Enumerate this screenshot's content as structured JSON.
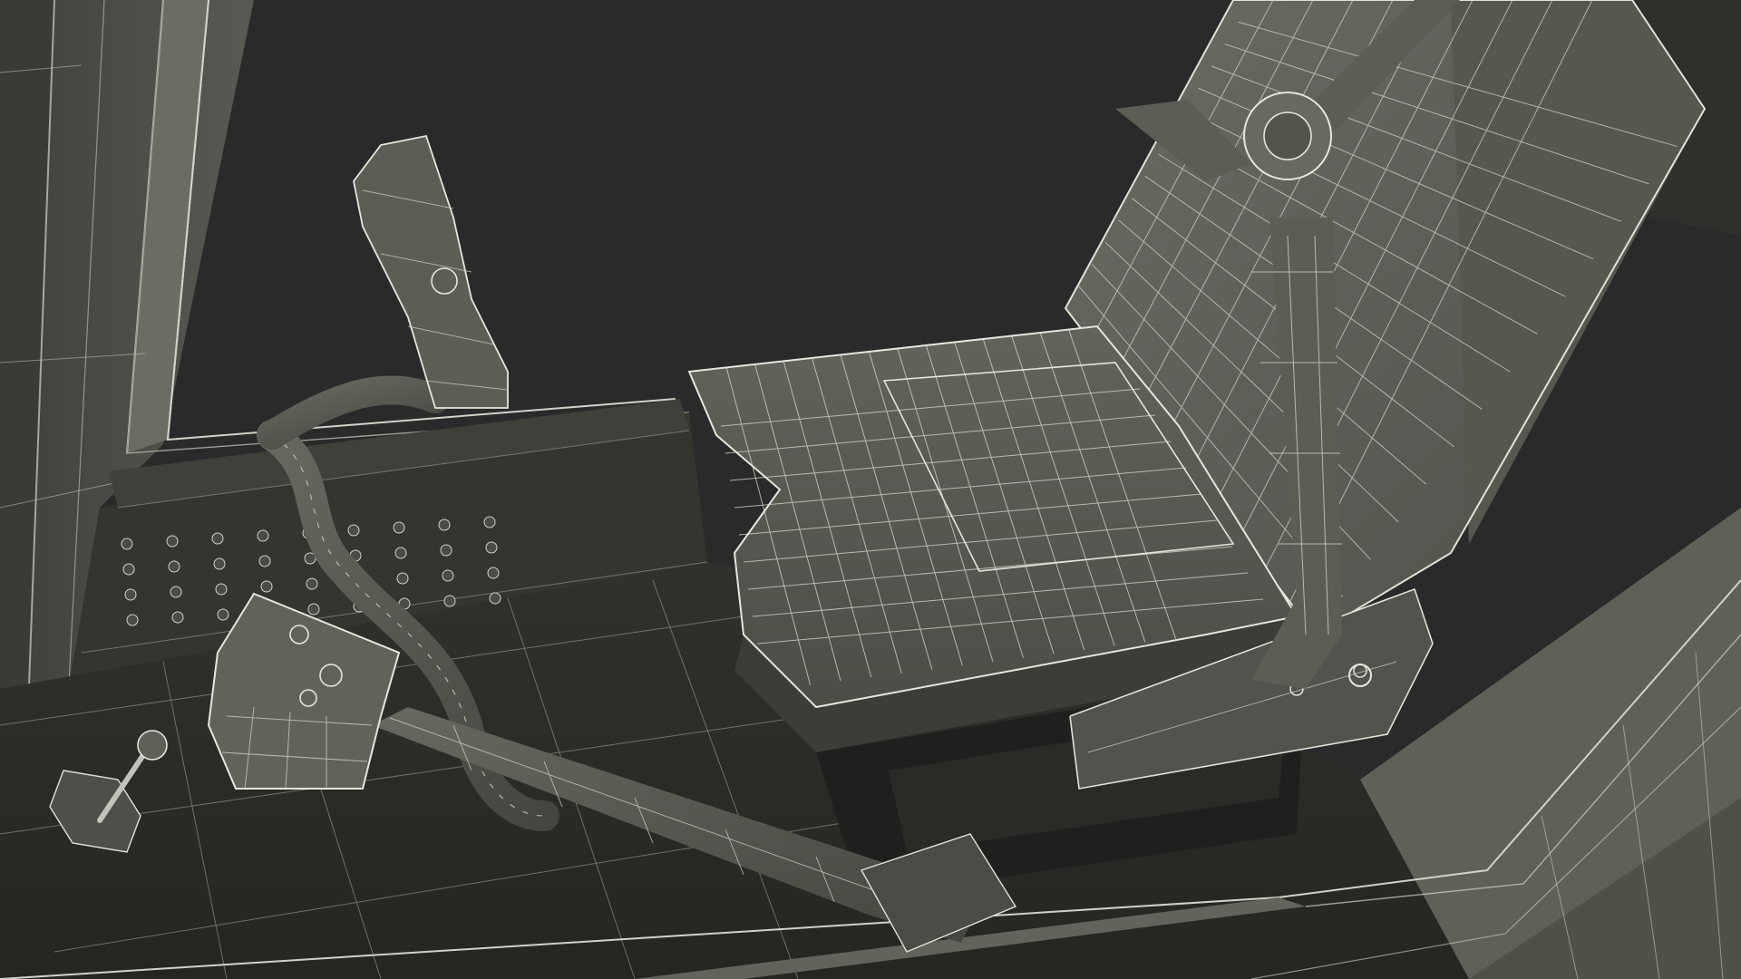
{
  "scene": {
    "kind": "3d-wireframe-render",
    "subject": "helicopter-cockpit-pilot-seat",
    "colors": {
      "background": "#2a2a2a",
      "shell": "#4a4a44",
      "shell_dark": "#34342f",
      "floor": "#2c2d29",
      "seat": "#5a5c55",
      "seat_dark": "#444640",
      "wire": "#cfd3c8",
      "wire_dim": "#9aa093"
    },
    "objects": [
      "cockpit-frame",
      "window-opening",
      "floor-panel",
      "fastener-rivets",
      "pilot-seat",
      "seat-belt-harness",
      "cyclic-control-stick",
      "collective-lever",
      "collective-head",
      "throttle-quadrant"
    ]
  }
}
